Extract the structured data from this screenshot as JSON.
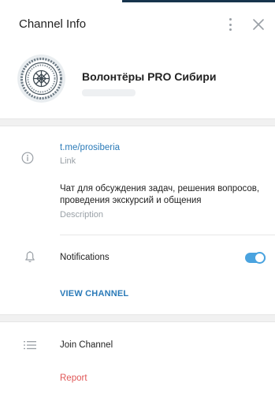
{
  "header": {
    "title": "Channel Info",
    "more_icon": "more-vertical-icon",
    "close_icon": "close-icon"
  },
  "profile": {
    "name": "Волонтёры PRO Сибири"
  },
  "info": {
    "link": "t.me/prosiberia",
    "link_label": "Link",
    "description": "Чат для обсуждения задач, решения вопросов, проведения экскурсий и общения",
    "description_label": "Description"
  },
  "notifications": {
    "label": "Notifications",
    "enabled": true
  },
  "actions": {
    "view_channel": "VIEW CHANNEL",
    "join": "Join Channel",
    "report": "Report"
  },
  "colors": {
    "accent": "#2a7ab8",
    "toggle": "#4aa3df",
    "danger": "#e05757",
    "muted": "#9aa1a7"
  }
}
